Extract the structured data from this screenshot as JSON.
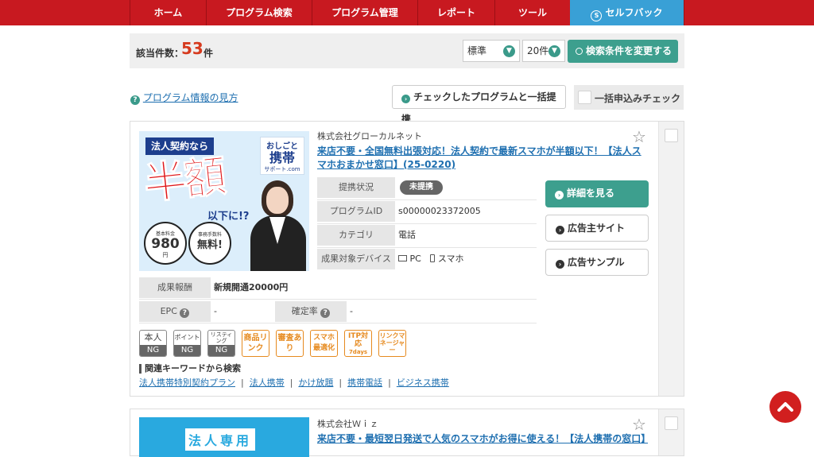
{
  "nav": {
    "items": [
      "ホーム",
      "プログラム検索",
      "プログラム管理",
      "レポート",
      "ツール",
      "セルフバック"
    ]
  },
  "summary": {
    "count_label": "該当件数：",
    "count": "53",
    "unit": "件",
    "sort_value": "標準",
    "per_page_value": "20件",
    "change_button": "検索条件を変更する"
  },
  "actions": {
    "help_link": "プログラム情報の見方",
    "bulk_partner_button": "チェックしたプログラムと一括提携",
    "bulk_apply_label": "一括申込みチェック"
  },
  "program1": {
    "advertiser": "株式会社グローカルネット",
    "title": "来店不要・全国無料出張対応！法人契約で最新スマホが半額以下！【法人スマホおまかせ窓口】(25-0220)",
    "banner": {
      "ribbon": "法人契約なら",
      "main": "半額",
      "sub": "以下に!?",
      "logo_top": "おしごと",
      "logo_mid": "携帯",
      "logo_bottom": "サポート.com",
      "badge1_top": "基本料金",
      "badge1_num": "980",
      "badge1_unit": "円",
      "badge2_top": "事務手数料",
      "badge2_main": "無料!"
    },
    "status_label": "提携状況",
    "status_value": "未提携",
    "id_label": "プログラムID",
    "id_value": "s00000023372005",
    "category_label": "カテゴリ",
    "category_value": "電話",
    "device_label": "成果対象デバイス",
    "device_pc": "PC",
    "device_sp": "スマホ",
    "reward_label": "成果報酬",
    "reward_value": "新規開通20000円",
    "epc_label": "EPC",
    "epc_value": "-",
    "rate_label": "確定率",
    "rate_value": "-",
    "tags": [
      {
        "top": "本人",
        "bottom": "NG"
      },
      {
        "top": "ポイント",
        "bottom": "NG"
      },
      {
        "top": "リスティング",
        "bottom": "NG"
      },
      {
        "text": "商品リンク"
      },
      {
        "text": "審査あり"
      },
      {
        "text": "スマホ最適化"
      },
      {
        "text": "ITP対応",
        "sub": "7days"
      },
      {
        "text": "リンクマネージャー"
      }
    ],
    "keywords_title": "関連キーワードから検索",
    "keywords": [
      "法人携帯特別契約プラン",
      "法人携帯",
      "かけ放題",
      "携帯電話",
      "ビジネス携帯"
    ],
    "detail_button": "詳細を見る",
    "site_button": "広告主サイト",
    "sample_button": "広告サンプル"
  },
  "program2": {
    "advertiser": "株式会社Ｗｉｚ",
    "title": "来店不要・最短翌日発送で人気のスマホがお得に使える！【法人携帯の窓口】",
    "banner_text": "法人専用"
  },
  "colors": {
    "nav": "#c81920",
    "active_tab": "#39a0d6",
    "accent": "#3d9f8e",
    "count": "#d63a1e",
    "tag_orange": "#e68a1f"
  }
}
